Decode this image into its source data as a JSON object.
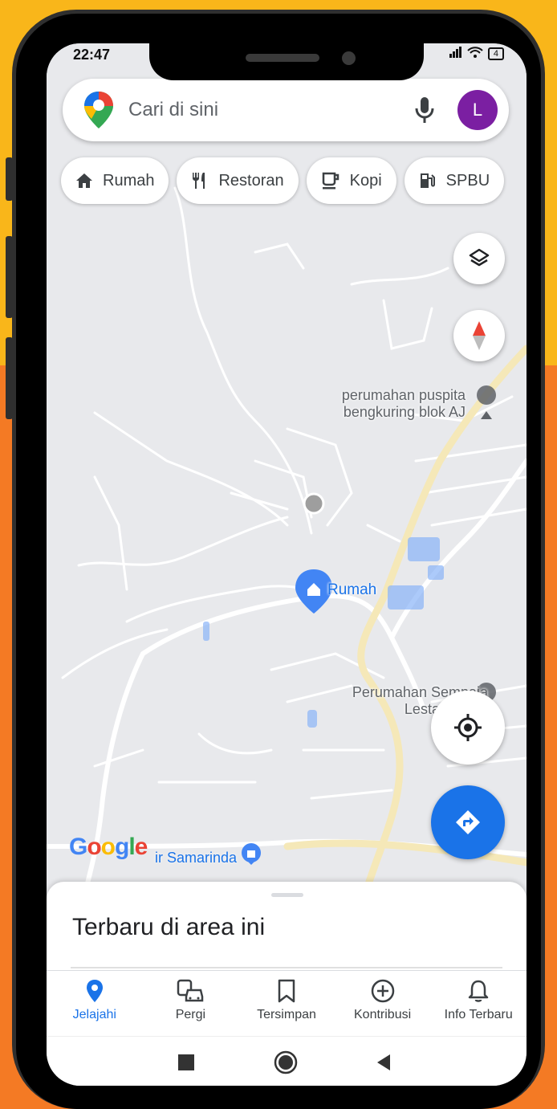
{
  "status_bar": {
    "time": "22:47",
    "battery": "4"
  },
  "search": {
    "placeholder": "Cari di sini",
    "avatar_letter": "L"
  },
  "chips": [
    {
      "label": "Rumah",
      "icon": "home-icon"
    },
    {
      "label": "Restoran",
      "icon": "restaurant-icon"
    },
    {
      "label": "Kopi",
      "icon": "coffee-icon"
    },
    {
      "label": "SPBU",
      "icon": "gas-station-icon"
    }
  ],
  "map": {
    "places": [
      {
        "line1": "perumahan puspita",
        "line2": "bengkuring blok AJ"
      },
      {
        "line1": "Perumahan Sempaja",
        "line2": "Lestari Indah"
      }
    ],
    "home_label": "Rumah",
    "bottom_place": "ir Samarinda",
    "google": [
      "G",
      "o",
      "o",
      "g",
      "l",
      "e"
    ]
  },
  "sheet": {
    "title": "Terbaru di area ini"
  },
  "nav": [
    {
      "label": "Jelajahi",
      "icon": "explore-pin-icon",
      "active": true
    },
    {
      "label": "Pergi",
      "icon": "commute-icon"
    },
    {
      "label": "Tersimpan",
      "icon": "bookmark-icon"
    },
    {
      "label": "Kontribusi",
      "icon": "add-circle-icon"
    },
    {
      "label": "Info Terbaru",
      "icon": "bell-icon"
    }
  ],
  "colors": {
    "accent": "#1a73e8",
    "avatar": "#7b1fa2",
    "frame_top": "#f9b61a",
    "frame_bottom": "#f47a24"
  }
}
